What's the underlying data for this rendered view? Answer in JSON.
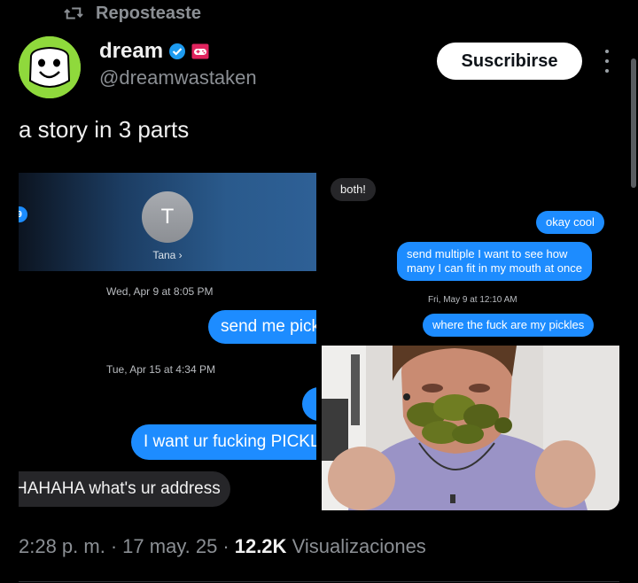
{
  "repost": {
    "icon": "repost-icon",
    "label": "Reposteaste"
  },
  "author": {
    "name": "dream",
    "handle": "@dreamwastaken",
    "verified_icon": "verified-badge-icon",
    "badge_icon": "gamepad-icon",
    "avatar": "smiley-face-avatar"
  },
  "subscribe_label": "Suscribirse",
  "tweet_text": "a story in 3 parts",
  "media_left": {
    "contact_initial": "T",
    "contact_name": "Tana",
    "stamp1": "Wed, Apr 9 at 8:05 PM",
    "msg1": "send me pickles",
    "stamp2": "Tue, Apr 15 at 4:34 PM",
    "msg2": "I want ur fucking PICKLES",
    "reply": "HAHAHA what's ur address"
  },
  "media_right": {
    "reply": "both!",
    "msg1": "okay cool",
    "msg2_line1": "send multiple I want to see how",
    "msg2_line2": "many I can fit in my mouth at once",
    "stamp": "Fri, May 9 at 12:10 AM",
    "msg3": "where the fuck are my pickles"
  },
  "footer": {
    "time": "2:28 p. m.",
    "date": "17 may. 25",
    "views_count": "12.2K",
    "views_label": "Visualizaciones",
    "sep": "·"
  },
  "colors": {
    "imessage_blue": "#1d8cff",
    "avatar_green": "#8fd93c",
    "verified_blue": "#1d9bf0",
    "badge_red": "#e0245e"
  }
}
